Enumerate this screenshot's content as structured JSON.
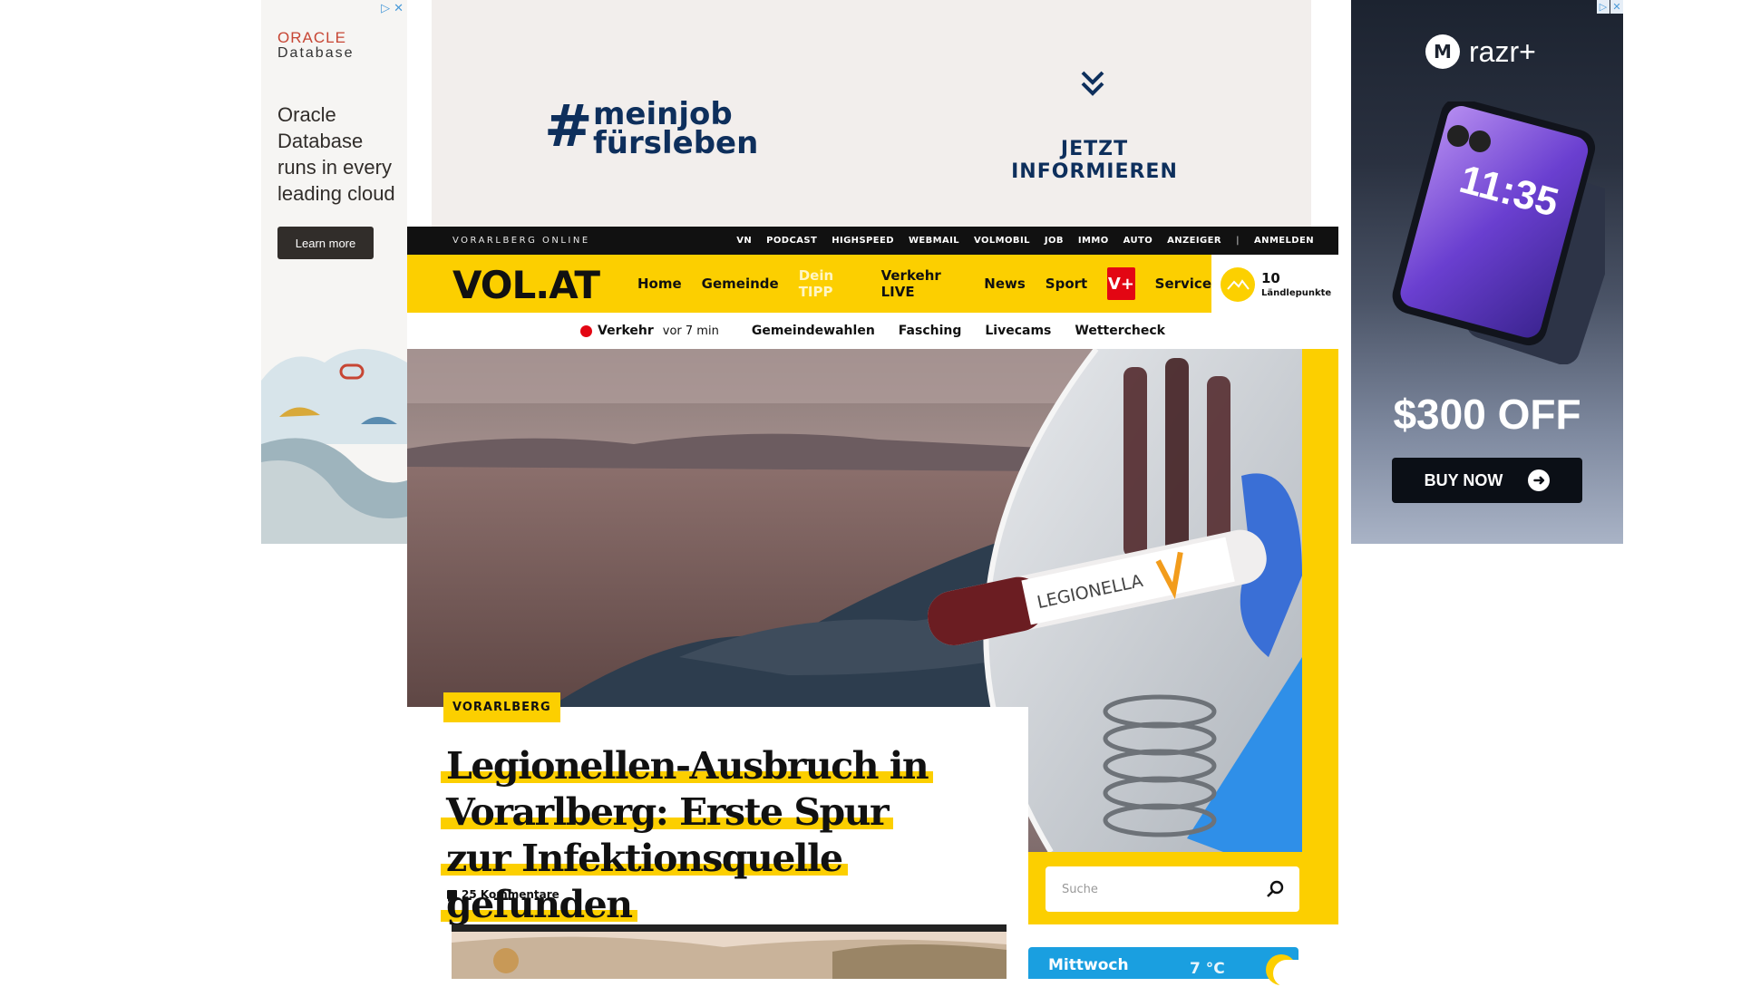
{
  "ads": {
    "left": {
      "logo_line1": "ORACLE",
      "logo_line2": "Database",
      "text": "Oracle Database runs in every leading cloud",
      "button": "Learn more"
    },
    "top": {
      "hashtag": "#",
      "line1": "meinjob",
      "line2": "fürsleben",
      "cta": "JETZT INFORMIEREN"
    },
    "right": {
      "brand_mark": "M",
      "brand": "razr+",
      "offer": "$300 OFF",
      "button": "BUY NOW",
      "clock": "11:35"
    }
  },
  "header": {
    "brand": "VORARLBERG ONLINE",
    "top_links": [
      "VN",
      "PODCAST",
      "HIGHSPEED",
      "WEBMAIL",
      "VOLMOBIL",
      "JOB",
      "IMMO",
      "AUTO",
      "ANZEIGER"
    ],
    "top_sep": "|",
    "login": "ANMELDEN",
    "logo": "VOL.AT",
    "nav": {
      "home": "Home",
      "gemeinde": "Gemeinde",
      "tipp": "Dein TIPP",
      "verkehr": "Verkehr LIVE",
      "news": "News",
      "sport": "Sport",
      "vplus": "V+",
      "service": "Service"
    },
    "points": {
      "value": "10",
      "label": "Ländlepunkte"
    }
  },
  "subnav": {
    "verkehr": "Verkehr",
    "verkehr_time": "vor 7 min",
    "items": [
      "Gemeindewahlen",
      "Fasching",
      "Livecams",
      "Wettercheck"
    ]
  },
  "article": {
    "category": "VORARLBERG",
    "headline": "Legionellen-Ausbruch in Vorarlberg: Erste Spur zur Infektionsquelle gefunden",
    "comments": "25 Kommentare",
    "image_label": "LEGIONELLA"
  },
  "search": {
    "placeholder": "Suche"
  },
  "weather": {
    "day": "Mittwoch",
    "temp": "7 °C"
  },
  "colors": {
    "accent": "#fccf00",
    "topbar": "#111111",
    "vplus": "#e30613",
    "weather": "#1a9fe0"
  }
}
